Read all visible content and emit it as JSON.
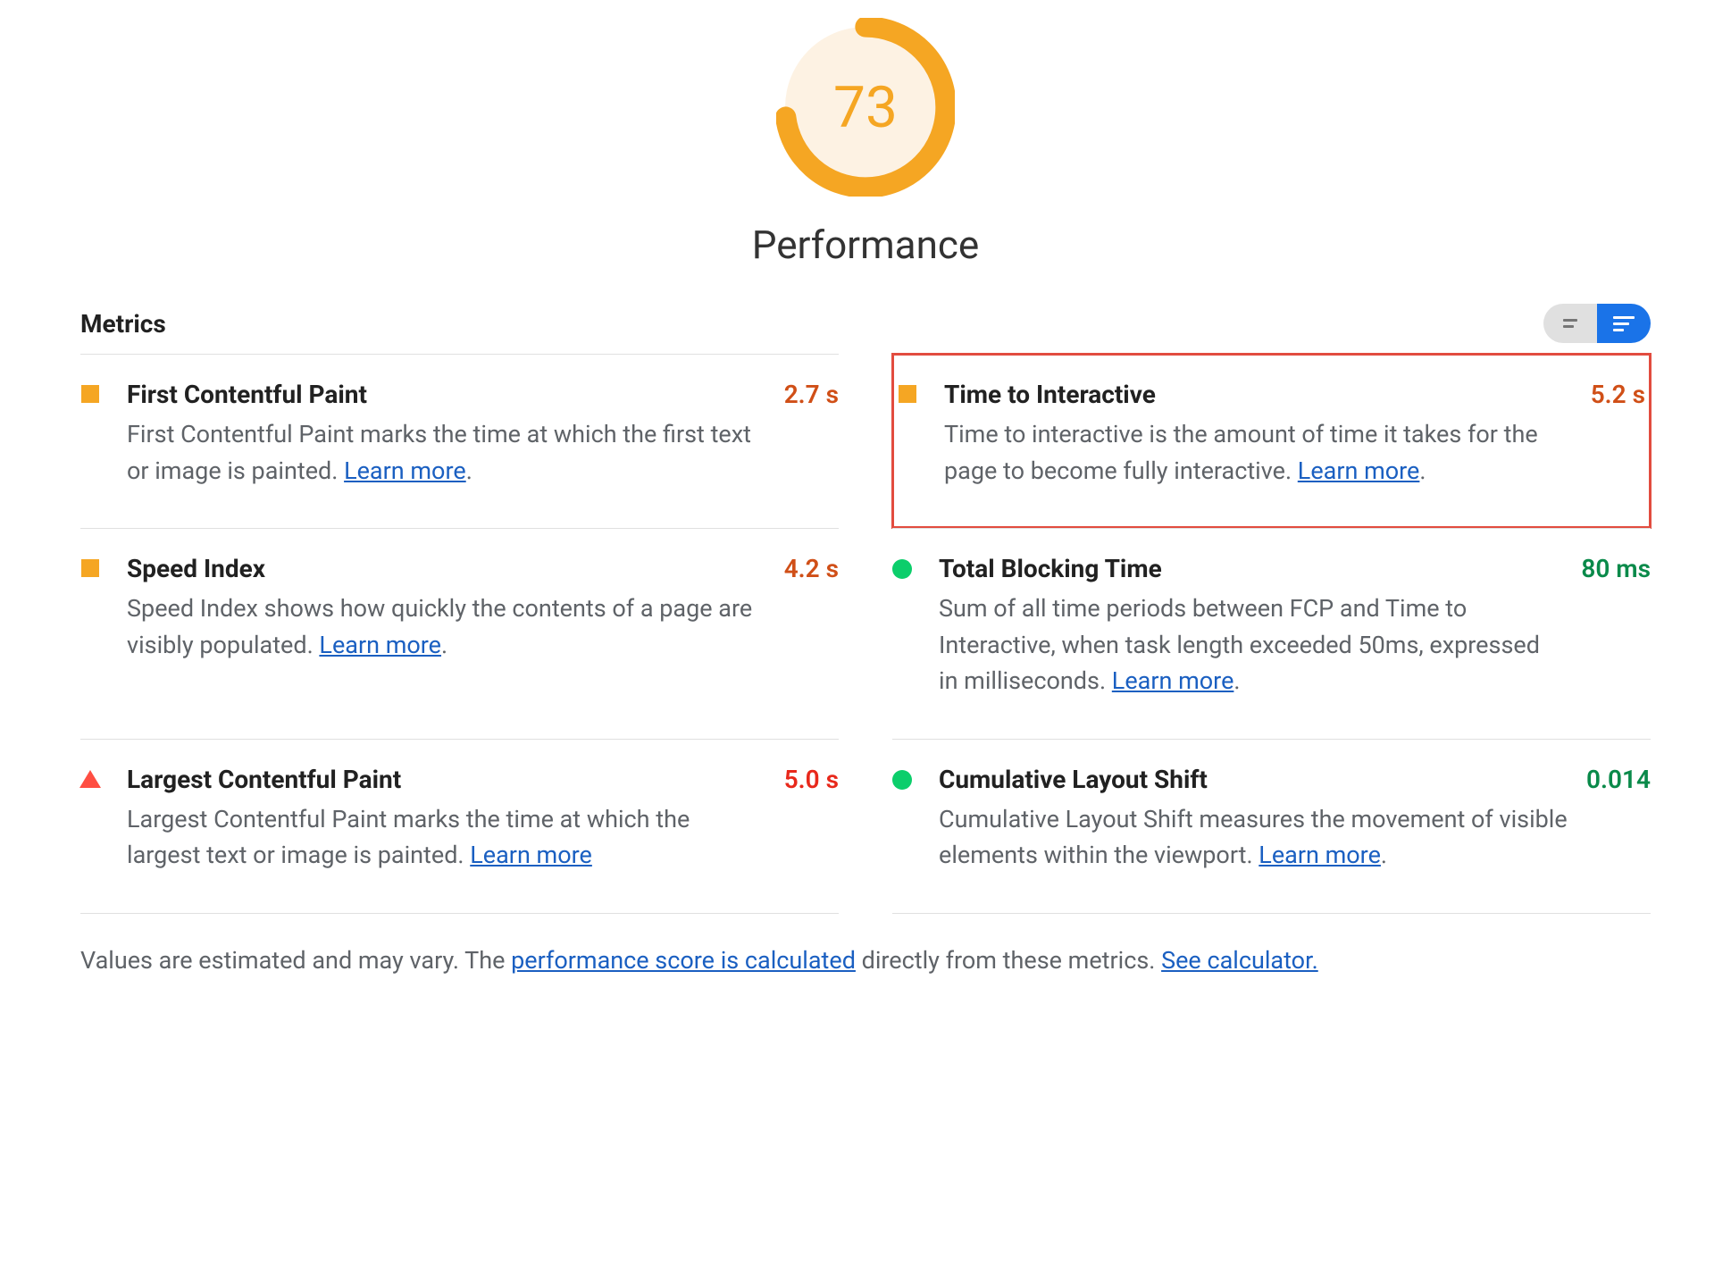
{
  "gauge": {
    "score": "73",
    "score_number": 73,
    "title": "Performance",
    "color": "#f5a623",
    "bg": "#fdf2e3"
  },
  "header": {
    "label": "Metrics"
  },
  "metrics": [
    {
      "id": "first-contentful-paint",
      "icon": "square",
      "status_color": "#f5a623",
      "title": "First Contentful Paint",
      "desc": "First Contentful Paint marks the time at which the first text or image is painted. ",
      "learn_more": "Learn more",
      "trailing_period": true,
      "value": "2.7 s",
      "value_color": "#d04f17",
      "highlighted": false
    },
    {
      "id": "time-to-interactive",
      "icon": "square",
      "status_color": "#f5a623",
      "title": "Time to Interactive",
      "desc": "Time to interactive is the amount of time it takes for the page to become fully interactive. ",
      "learn_more": "Learn more",
      "trailing_period": true,
      "value": "5.2 s",
      "value_color": "#d04f17",
      "highlighted": true
    },
    {
      "id": "speed-index",
      "icon": "square",
      "status_color": "#f5a623",
      "title": "Speed Index",
      "desc": "Speed Index shows how quickly the contents of a page are visibly populated. ",
      "learn_more": "Learn more",
      "trailing_period": true,
      "value": "4.2 s",
      "value_color": "#d04f17",
      "highlighted": false
    },
    {
      "id": "total-blocking-time",
      "icon": "circle",
      "status_color": "#0cce6b",
      "title": "Total Blocking Time",
      "desc": "Sum of all time periods between FCP and Time to Interactive, when task length exceeded 50ms, expressed in milliseconds. ",
      "learn_more": "Learn more",
      "trailing_period": true,
      "value": "80 ms",
      "value_color": "#0a8a4a",
      "highlighted": false
    },
    {
      "id": "largest-contentful-paint",
      "icon": "triangle",
      "status_color": "#ff4e42",
      "title": "Largest Contentful Paint",
      "desc": "Largest Contentful Paint marks the time at which the largest text or image is painted. ",
      "learn_more": "Learn more",
      "trailing_period": false,
      "value": "5.0 s",
      "value_color": "#e8281b",
      "highlighted": false
    },
    {
      "id": "cumulative-layout-shift",
      "icon": "circle",
      "status_color": "#0cce6b",
      "title": "Cumulative Layout Shift",
      "desc": "Cumulative Layout Shift measures the movement of visible elements within the viewport. ",
      "learn_more": "Learn more",
      "trailing_period": true,
      "value": "0.014",
      "value_color": "#0a8a4a",
      "highlighted": false
    }
  ],
  "footer": {
    "prefix": "Values are estimated and may vary. The ",
    "link1": "performance score is calculated",
    "middle": " directly from these metrics. ",
    "link2": "See calculator."
  }
}
